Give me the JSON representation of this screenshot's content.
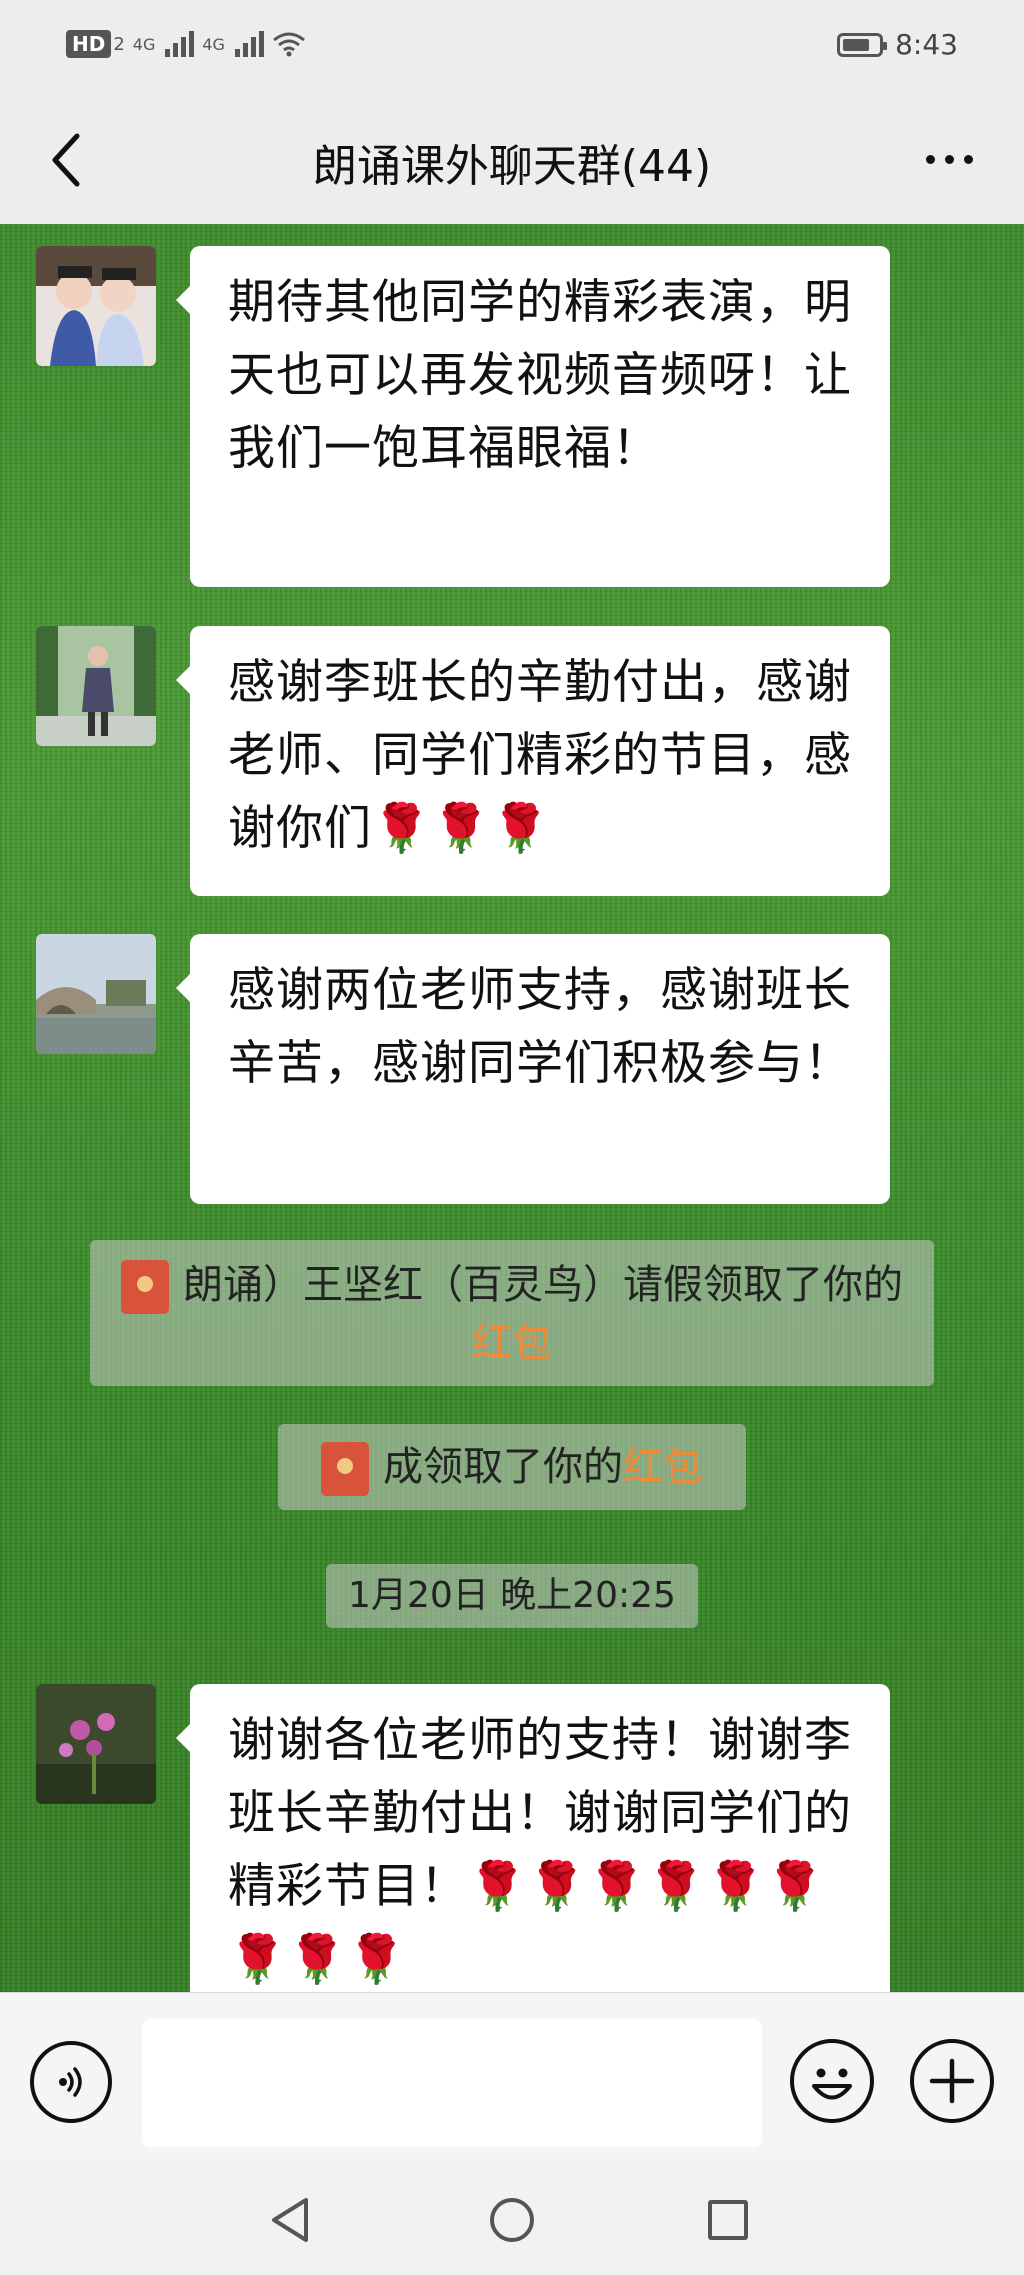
{
  "statusbar": {
    "hd": "HD",
    "sim": "2",
    "net1": "4G",
    "net2": "4G",
    "time": "8:43",
    "battery_level": 0.75
  },
  "header": {
    "title": "朗诵课外聊天群(44)",
    "back_icon": "chevron-left-icon",
    "more_icon": "more-dots-icon"
  },
  "messages": [
    {
      "text": "期待其他同学的精彩表演，明天也可以再发视频音频呀！让我们一饱耳福眼福！"
    },
    {
      "text": "感谢李班长的辛勤付出，感谢老师、同学们精彩的节目，感谢你们",
      "roses": "🌹🌹🌹"
    },
    {
      "text": "感谢两位老师支持，感谢班长辛苦，感谢同学们积极参与！"
    },
    {
      "text": "谢谢各位老师的支持！谢谢李班长辛勤付出！谢谢同学们的精彩节目！",
      "roses": "🌹🌹🌹🌹🌹🌹🌹🌹🌹"
    }
  ],
  "system": [
    {
      "text": "朗诵）王坚红（百灵鸟）请假领取了你的",
      "highlight": "红包"
    },
    {
      "text": "成领取了你的",
      "highlight": "红包"
    }
  ],
  "timestamp": "1月20日 晚上20:25",
  "input": {
    "placeholder": ""
  },
  "colors": {
    "accent": "#f08a36",
    "bubble": "#ffffff",
    "header_bg": "#ededed",
    "redpacket": "#d9533a"
  }
}
